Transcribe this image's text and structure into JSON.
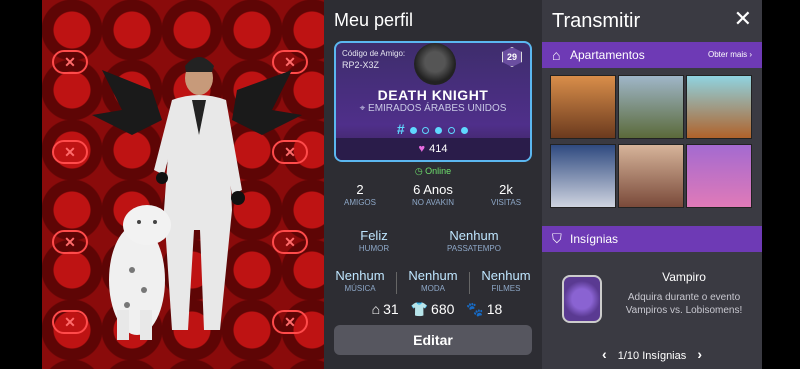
{
  "profile": {
    "title": "Meu perfil",
    "friend_code_label": "Código de Amigo:",
    "friend_code": "RP2-X3Z",
    "level": "29",
    "username": "DEATH KNIGHT",
    "country": "EMIRADOS ÁRABES UNIDOS",
    "hash_symbol": "#",
    "likes": "414",
    "status": "Online",
    "stats": [
      {
        "value": "2",
        "label": "AMIGOS"
      },
      {
        "value": "6 Anos",
        "label": "NO AVAKIN"
      },
      {
        "value": "2k",
        "label": "VISITAS"
      }
    ],
    "mood": {
      "value": "Feliz",
      "label": "HUMOR"
    },
    "hobby": {
      "value": "Nenhum",
      "label": "PASSATEMPO"
    },
    "tastes": [
      {
        "value": "Nenhum",
        "label": "MÚSICA"
      },
      {
        "value": "Nenhum",
        "label": "MODA"
      },
      {
        "value": "Nenhum",
        "label": "FILMES"
      }
    ],
    "counts": {
      "homes": "31",
      "outfits": "680",
      "pets": "18"
    },
    "edit_label": "Editar"
  },
  "stream": {
    "title": "Transmitir",
    "close_icon": "close-icon",
    "apartments_label": "Apartamentos",
    "more_label": "Obter mais ›",
    "badges_label": "Insígnias",
    "badge": {
      "title": "Vampiro",
      "description": "Adquira durante o evento Vampiros vs. Lobisomens!"
    },
    "pager": "1/10 Insígnias"
  },
  "colors": {
    "accent": "#6e3ab5",
    "online": "#6ee06e",
    "hash": "#5fd8ff"
  }
}
